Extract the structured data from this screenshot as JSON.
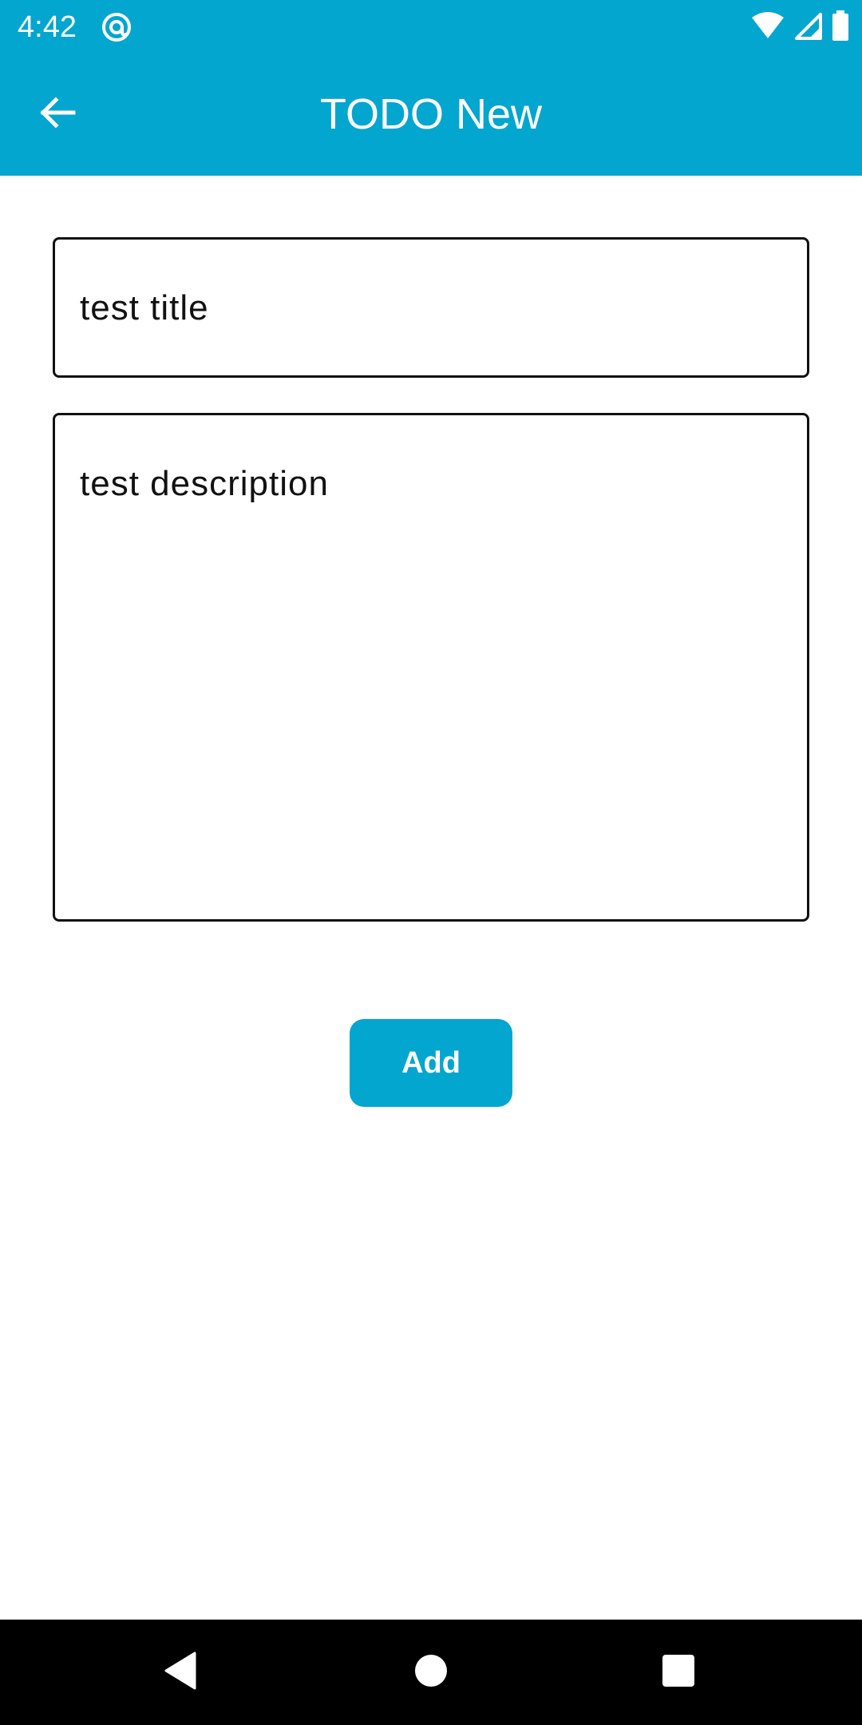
{
  "status_bar": {
    "time": "4:42",
    "app_icon": "at-sync-icon",
    "indicators": [
      "wifi-icon",
      "cellular-signal-icon",
      "battery-icon"
    ]
  },
  "toolbar": {
    "back_icon": "arrow-back-icon",
    "title": "TODO New"
  },
  "form": {
    "title_value": "test title",
    "description_value": "test description",
    "add_label": "Add"
  },
  "nav_bar": {
    "buttons": [
      "back-triangle-icon",
      "home-circle-icon",
      "recents-square-icon"
    ]
  },
  "colors": {
    "accent": "#03a6ce",
    "text": "#111111",
    "background": "#ffffff",
    "nav_background": "#000000"
  }
}
